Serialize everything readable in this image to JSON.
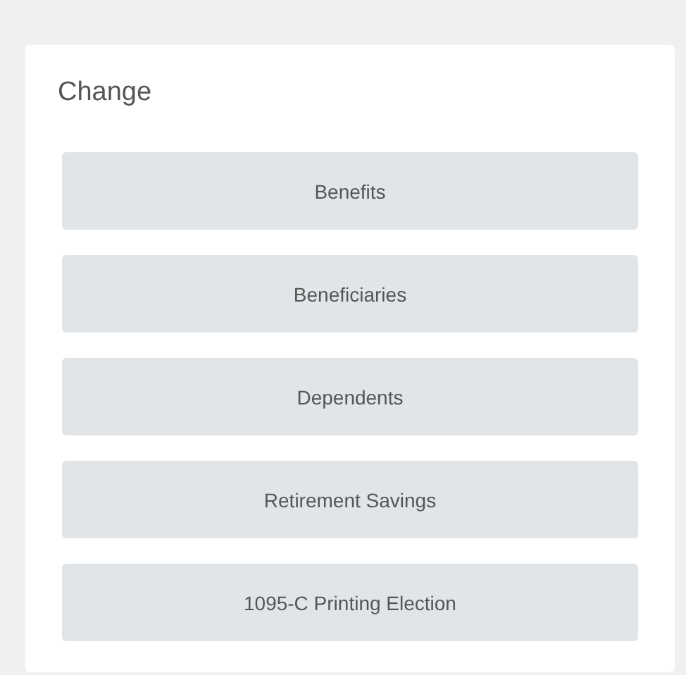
{
  "card": {
    "title": "Change",
    "buttons": [
      "Benefits",
      "Beneficiaries",
      "Dependents",
      "Retirement Savings",
      "1095-C Printing Election"
    ]
  }
}
